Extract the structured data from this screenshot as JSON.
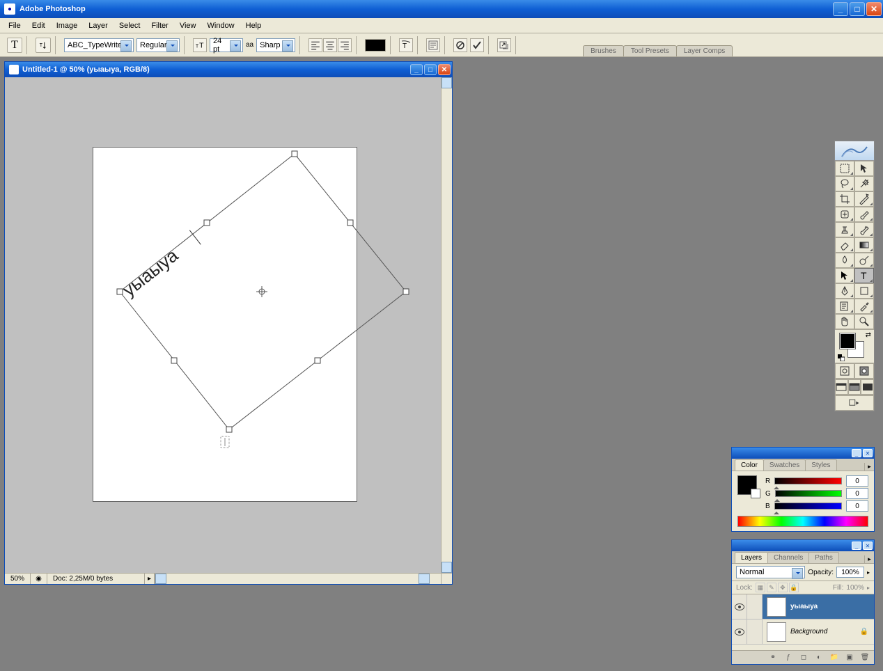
{
  "app": {
    "title": "Adobe Photoshop"
  },
  "menu": [
    "File",
    "Edit",
    "Image",
    "Layer",
    "Select",
    "Filter",
    "View",
    "Window",
    "Help"
  ],
  "options": {
    "font_family": "ABC_TypeWriter…",
    "font_style": "Regular",
    "font_size": "24 pt",
    "aa_label": "aa",
    "aa_method": "Sharp",
    "orient_icon": "text-orientation-icon"
  },
  "palette_tabs": [
    "Brushes",
    "Tool Presets",
    "Layer Comps"
  ],
  "document": {
    "title": "Untitled-1 @ 50% (уыаыуа, RGB/8)",
    "zoom": "50%",
    "doc_info": "Doc: 2,25M/0 bytes",
    "text_content": "уыаыуа"
  },
  "color_panel": {
    "tabs": [
      "Color",
      "Swatches",
      "Styles"
    ],
    "channels": [
      {
        "label": "R",
        "value": "0"
      },
      {
        "label": "G",
        "value": "0"
      },
      {
        "label": "B",
        "value": "0"
      }
    ]
  },
  "layers_panel": {
    "tabs": [
      "Layers",
      "Channels",
      "Paths"
    ],
    "blend_mode": "Normal",
    "opacity_label": "Opacity:",
    "opacity": "100%",
    "lock_label": "Lock:",
    "fill_label": "Fill:",
    "fill": "100%",
    "layers": [
      {
        "name": "уыаыуа",
        "type": "text",
        "active": true
      },
      {
        "name": "Background",
        "type": "bg",
        "active": false,
        "locked": true
      }
    ]
  }
}
